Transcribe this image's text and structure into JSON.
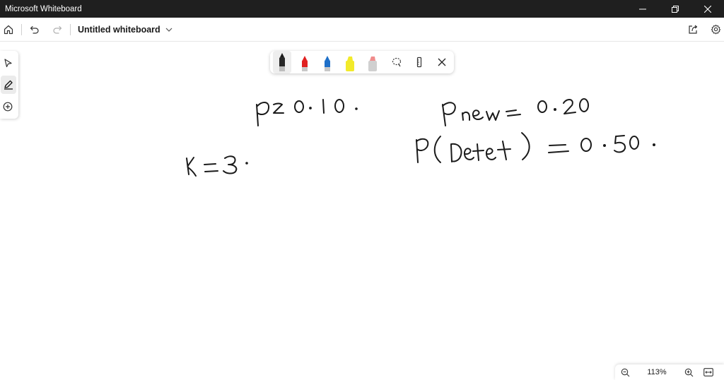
{
  "app": {
    "window_title": "Microsoft Whiteboard"
  },
  "toolbar": {
    "document_title": "Untitled whiteboard"
  },
  "ink_tray": {
    "pens": [
      {
        "name": "black-pen",
        "color": "#1a1a1a"
      },
      {
        "name": "red-pen",
        "color": "#e02020"
      },
      {
        "name": "blue-pen",
        "color": "#1e6fc8"
      },
      {
        "name": "yellow-highlighter",
        "color": "#f2ea2a"
      },
      {
        "name": "pink-highlighter",
        "color": "#f08c8c"
      }
    ]
  },
  "colors": {
    "ink": "#1a1a1a",
    "titlebar": "#1f1f1f"
  },
  "zoom": {
    "value": "113%"
  }
}
